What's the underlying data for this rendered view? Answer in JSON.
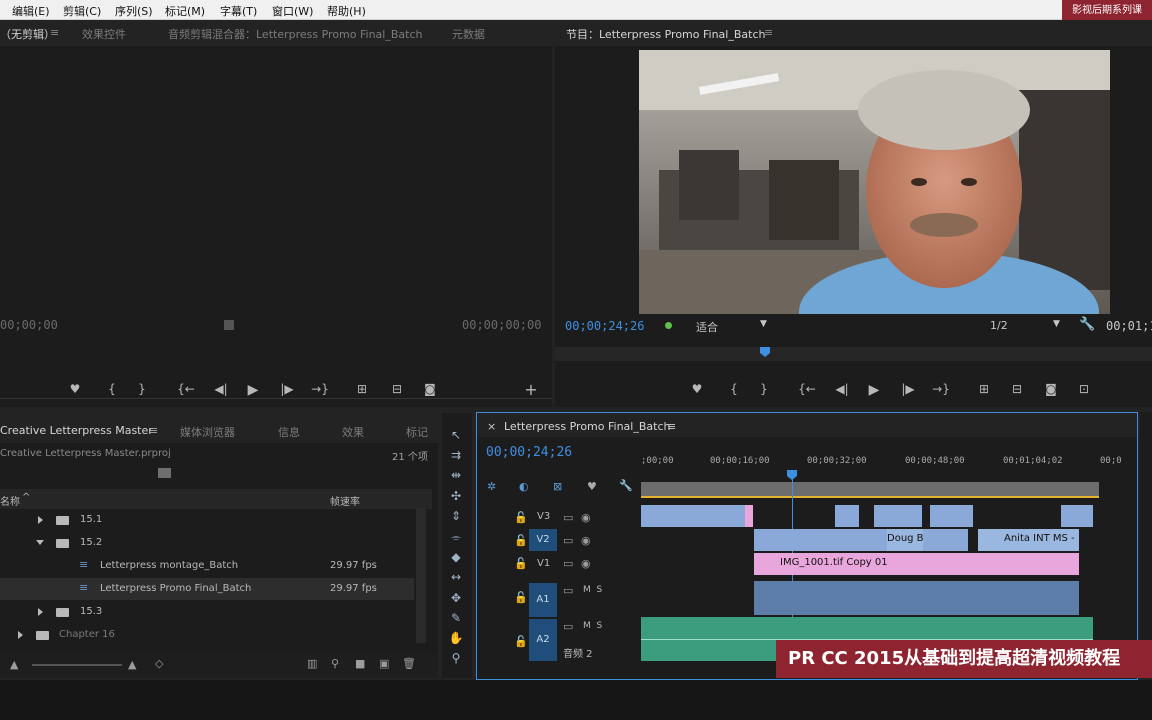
{
  "menu": [
    "编辑(E)",
    "剪辑(C)",
    "序列(S)",
    "标记(M)",
    "字幕(T)",
    "窗口(W)",
    "帮助(H)"
  ],
  "watermark_top_right": "影视后期系列课",
  "source_panel": {
    "tabs": [
      "（无剪辑）",
      "效果控件",
      "音频剪辑混合器：Letterpress Promo Final_Batch",
      "元数据"
    ],
    "timecode_left": "00;00;00",
    "timecode_right": "00;00;00;00"
  },
  "program_panel": {
    "title": "节目：Letterpress Promo Final_Batch",
    "timecode": "00;00;24;26",
    "fit": "适合",
    "resolution": "1/2",
    "timecode_right": "00;01;1"
  },
  "project_panel": {
    "tabs": [
      "Creative Letterpress Master",
      "媒体浏览器",
      "信息",
      "效果",
      "标记"
    ],
    "file_name": "Creative Letterpress Master.prproj",
    "item_count": "21 个项",
    "col_name": "名称",
    "col_fps": "帧速率",
    "rows": [
      {
        "label": "15.1",
        "kind": "folder",
        "state": "closed",
        "fps": ""
      },
      {
        "label": "15.2",
        "kind": "folder",
        "state": "open",
        "fps": ""
      },
      {
        "label": "Letterpress montage_Batch",
        "kind": "sequence",
        "state": "",
        "fps": "29.97 fps"
      },
      {
        "label": "Letterpress Promo Final_Batch",
        "kind": "sequence",
        "state": "",
        "fps": "29.97 fps"
      },
      {
        "label": "15.3",
        "kind": "folder",
        "state": "closed",
        "fps": ""
      },
      {
        "label": "Chapter 16",
        "kind": "folder",
        "state": "closed",
        "fps": ""
      }
    ]
  },
  "timeline": {
    "tab": "Letterpress Promo Final_Batch",
    "timecode": "00;00;24;26",
    "ruler": [
      ";00;00",
      "00;00;16;00",
      "00;00;32;00",
      "00;00;48;00",
      "00;01;04;02",
      "00;0"
    ],
    "tracks": [
      {
        "id": "V3",
        "type": "video",
        "toggles": ""
      },
      {
        "id": "V2",
        "type": "video",
        "toggles": ""
      },
      {
        "id": "V1",
        "type": "video",
        "toggles": ""
      },
      {
        "id": "A1",
        "type": "audio",
        "toggles": "M  S"
      },
      {
        "id": "A2",
        "type": "audio",
        "toggles": "M  S",
        "sub": "音频 2"
      }
    ],
    "clip_labels": {
      "doug": "Doug B",
      "anita": "Anita INT MS -",
      "v1": "IMG_1001.tif Copy 01"
    },
    "colors": {
      "accent": "#3f8fe0",
      "video_clip": "#8aa8d8",
      "v1_clip": "#e8a6dc",
      "audio_a1": "#5d7ea8",
      "audio_a2": "#3c9c7e"
    }
  },
  "banner": "PR CC 2015从基础到提高超清视频教程"
}
